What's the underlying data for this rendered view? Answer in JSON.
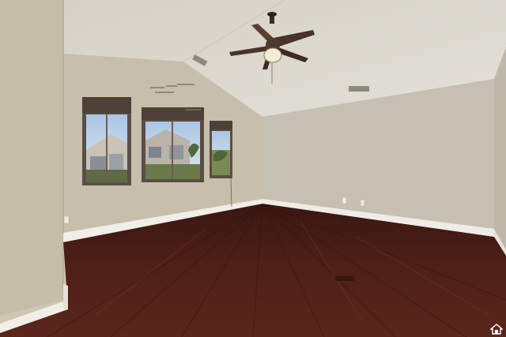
{
  "photo": {
    "subject": "empty-bedroom",
    "colors": {
      "wall_left": "#c9c0ad",
      "wall_back": "#c6c1b2",
      "wall_right": "#bfbaa9",
      "ceiling": "#dcd8ce",
      "floor": "#4a1d16",
      "baseboard": "#f1eee8",
      "fan_blade": "#4a3328",
      "window_frame": "#5a4e45"
    },
    "icons": [
      "ceiling-fan-icon",
      "home-icon"
    ]
  }
}
